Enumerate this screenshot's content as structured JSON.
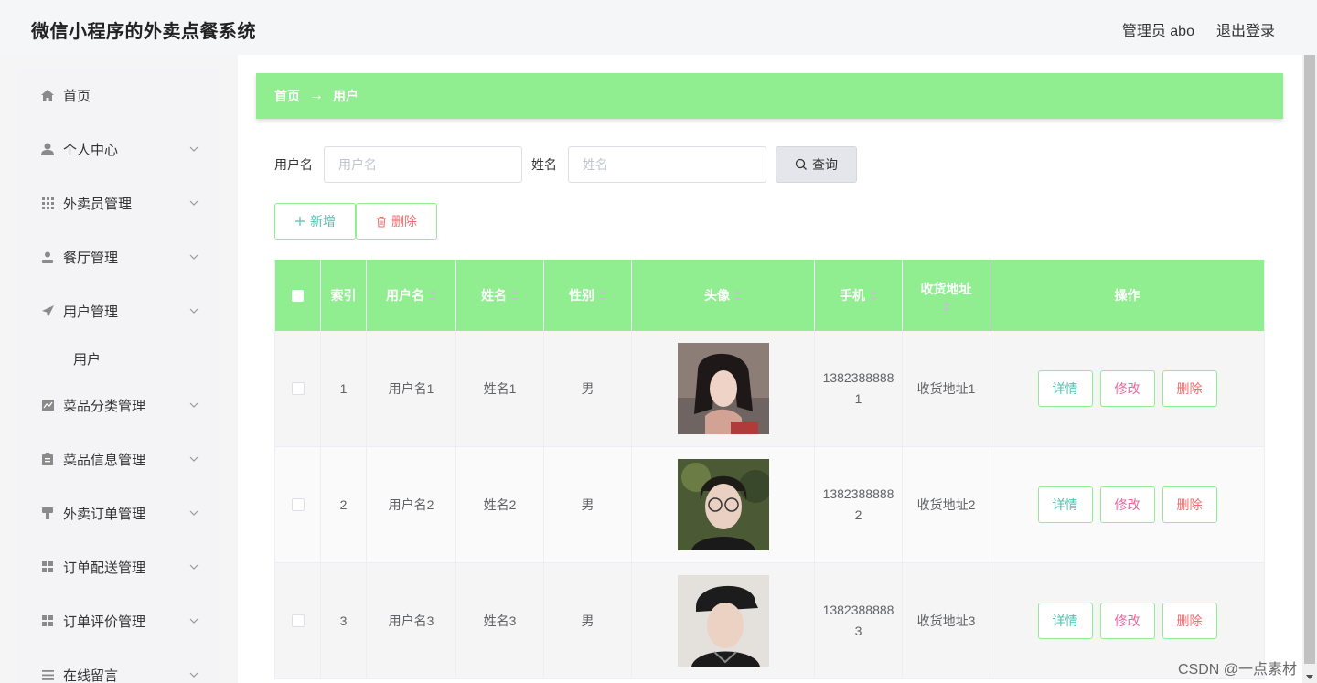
{
  "app": {
    "title": "微信小程序的外卖点餐系统",
    "user_label": "管理员 abo",
    "logout_label": "退出登录"
  },
  "sidebar": {
    "items": [
      {
        "label": "首页",
        "icon": "home-icon",
        "expandable": false
      },
      {
        "label": "个人中心",
        "icon": "user-icon",
        "expandable": true
      },
      {
        "label": "外卖员管理",
        "icon": "grid-icon",
        "expandable": true
      },
      {
        "label": "餐厅管理",
        "icon": "person-icon",
        "expandable": true
      },
      {
        "label": "用户管理",
        "icon": "send-icon",
        "expandable": true
      },
      {
        "label": "菜品分类管理",
        "icon": "chart-icon",
        "expandable": true
      },
      {
        "label": "菜品信息管理",
        "icon": "clipboard-icon",
        "expandable": true
      },
      {
        "label": "外卖订单管理",
        "icon": "stamp-icon",
        "expandable": true
      },
      {
        "label": "订单配送管理",
        "icon": "apps-icon",
        "expandable": true
      },
      {
        "label": "订单评价管理",
        "icon": "apps-icon",
        "expandable": true
      },
      {
        "label": "在线留言",
        "icon": "list-icon",
        "expandable": true
      }
    ],
    "sub_item": "用户"
  },
  "breadcrumb": {
    "home": "首页",
    "arrow": "→",
    "current": "用户"
  },
  "search": {
    "username_label": "用户名",
    "username_placeholder": "用户名",
    "name_label": "姓名",
    "name_placeholder": "姓名",
    "query_label": "查询"
  },
  "actions": {
    "add_label": "新增",
    "delete_label": "删除"
  },
  "table": {
    "columns": {
      "index": "索引",
      "username": "用户名",
      "name": "姓名",
      "gender": "性别",
      "avatar": "头像",
      "phone": "手机",
      "address": "收货地址",
      "ops": "操作"
    },
    "rows": [
      {
        "index": "1",
        "username": "用户名1",
        "name": "姓名1",
        "gender": "男",
        "phone": "13823888881",
        "address": "收货地址1"
      },
      {
        "index": "2",
        "username": "用户名2",
        "name": "姓名2",
        "gender": "男",
        "phone": "13823888882",
        "address": "收货地址2"
      },
      {
        "index": "3",
        "username": "用户名3",
        "name": "姓名3",
        "gender": "男",
        "phone": "13823888883",
        "address": "收货地址3"
      }
    ],
    "row_actions": {
      "detail": "详情",
      "edit": "修改",
      "delete": "删除"
    }
  },
  "watermark": "CSDN @一点素材",
  "colors": {
    "accent": "#90ee90",
    "teal": "#4fc2b1",
    "pink": "#e8679b",
    "red": "#f56c6c"
  }
}
